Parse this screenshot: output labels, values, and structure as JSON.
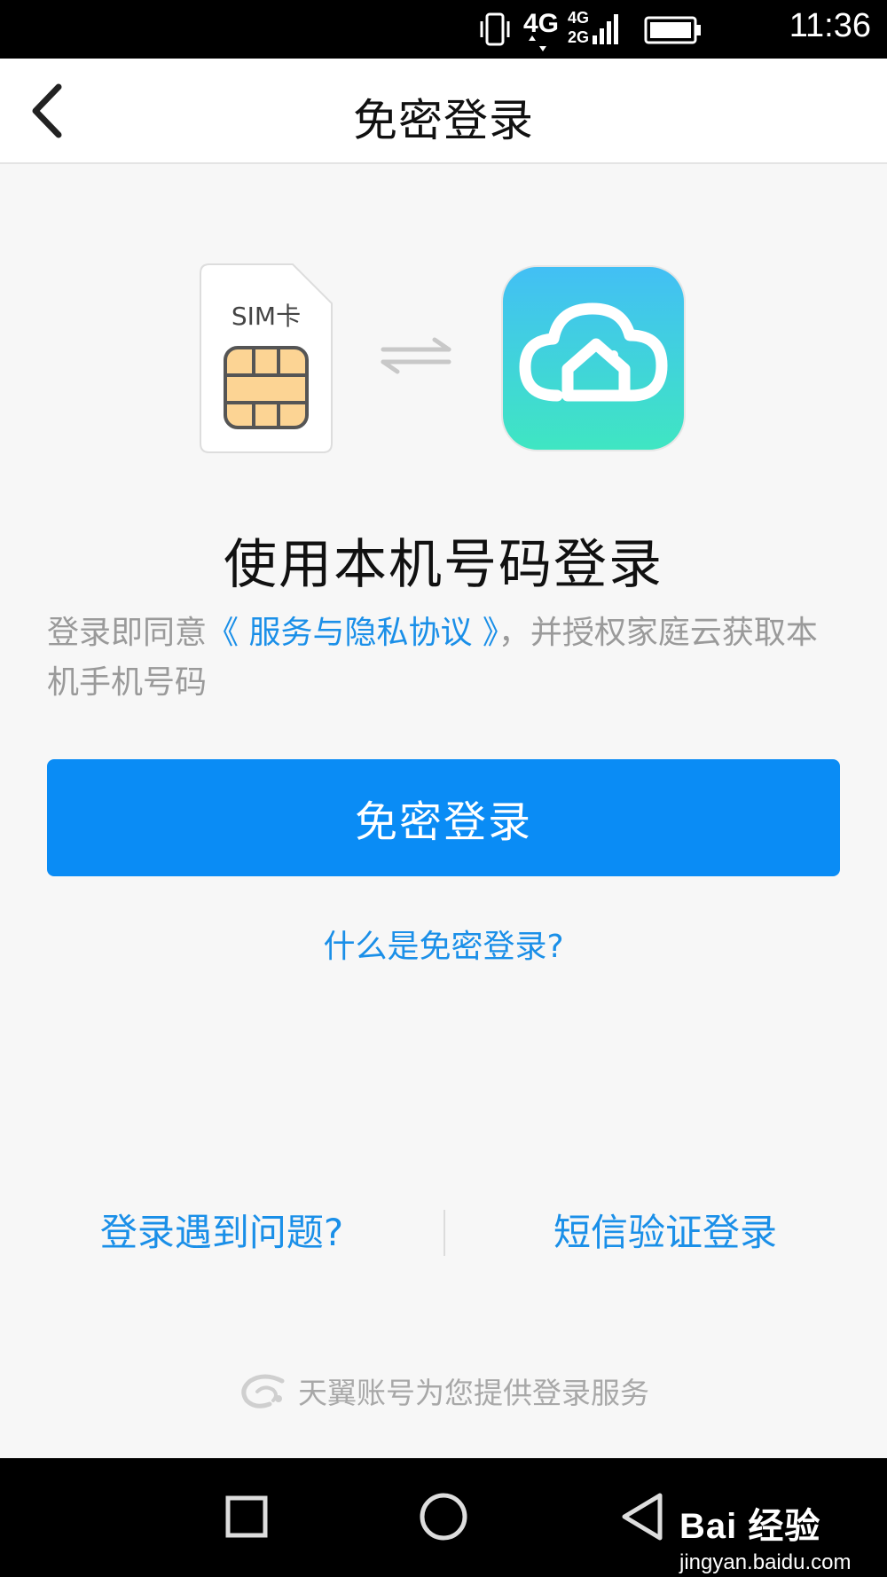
{
  "status_bar": {
    "time": "11:36",
    "network_1": "4G",
    "network_2_top": "4G",
    "network_2_bottom": "2G",
    "icons": [
      "vibrate-icon",
      "signal-icon",
      "battery-icon"
    ]
  },
  "nav": {
    "title": "免密登录",
    "back_icon": "chevron-left-icon"
  },
  "illustration": {
    "sim_label": "SIM卡",
    "swap_icon": "swap-arrows-icon",
    "app_icon": "cloud-home-icon"
  },
  "main": {
    "title": "使用本机号码登录",
    "agreement_prefix": "登录即同意",
    "agreement_link": "《 服务与隐私协议 》",
    "agreement_suffix": "，并授权家庭云获取本机手机号码",
    "login_button": "免密登录",
    "what_link": "什么是免密登录?"
  },
  "bottom": {
    "problem_link": "登录遇到问题?",
    "sms_link": "短信验证登录",
    "provider_text": "天翼账号为您提供登录服务"
  },
  "watermark": {
    "brand": "Bai  经验",
    "sub": "jingyan.baidu.com"
  },
  "colors": {
    "accent": "#0a8cf5",
    "link": "#1a8fe8",
    "background": "#f7f7f7"
  }
}
